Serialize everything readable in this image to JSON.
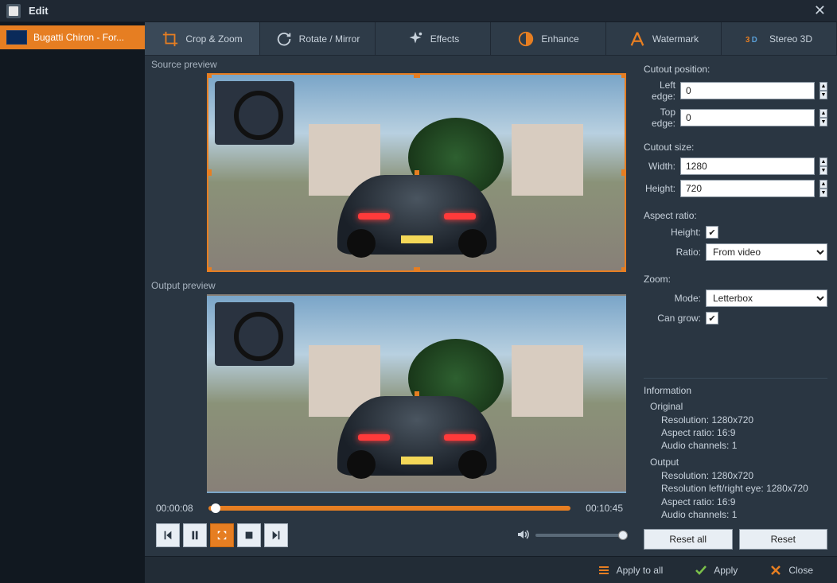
{
  "window": {
    "title": "Edit"
  },
  "file": {
    "name": "Bugatti Chiron - For..."
  },
  "tabs": {
    "crop": "Crop & Zoom",
    "rotate": "Rotate / Mirror",
    "effects": "Effects",
    "enhance": "Enhance",
    "watermark": "Watermark",
    "stereo3d": "Stereo 3D"
  },
  "labels": {
    "source_preview": "Source preview",
    "output_preview": "Output preview"
  },
  "timeline": {
    "current": "00:00:08",
    "total": "00:10:45"
  },
  "cutout_position": {
    "title": "Cutout position:",
    "left_edge_label": "Left edge:",
    "left_edge": "0",
    "top_edge_label": "Top edge:",
    "top_edge": "0"
  },
  "cutout_size": {
    "title": "Cutout size:",
    "width_label": "Width:",
    "width": "1280",
    "height_label": "Height:",
    "height": "720"
  },
  "aspect_ratio": {
    "title": "Aspect ratio:",
    "height_label": "Height:",
    "height_checked": true,
    "ratio_label": "Ratio:",
    "ratio_value": "From video"
  },
  "zoom": {
    "title": "Zoom:",
    "mode_label": "Mode:",
    "mode_value": "Letterbox",
    "can_grow_label": "Can grow:",
    "can_grow_checked": true
  },
  "info": {
    "title": "Information",
    "original": {
      "title": "Original",
      "resolution": "Resolution: 1280x720",
      "aspect": "Aspect ratio: 16:9",
      "audio": "Audio channels: 1"
    },
    "output": {
      "title": "Output",
      "resolution": "Resolution: 1280x720",
      "resolution_lr": "Resolution left/right eye: 1280x720",
      "aspect": "Aspect ratio: 16:9",
      "audio": "Audio channels: 1"
    }
  },
  "buttons": {
    "reset_all": "Reset all",
    "reset": "Reset",
    "apply_all": "Apply to all",
    "apply": "Apply",
    "close": "Close"
  }
}
